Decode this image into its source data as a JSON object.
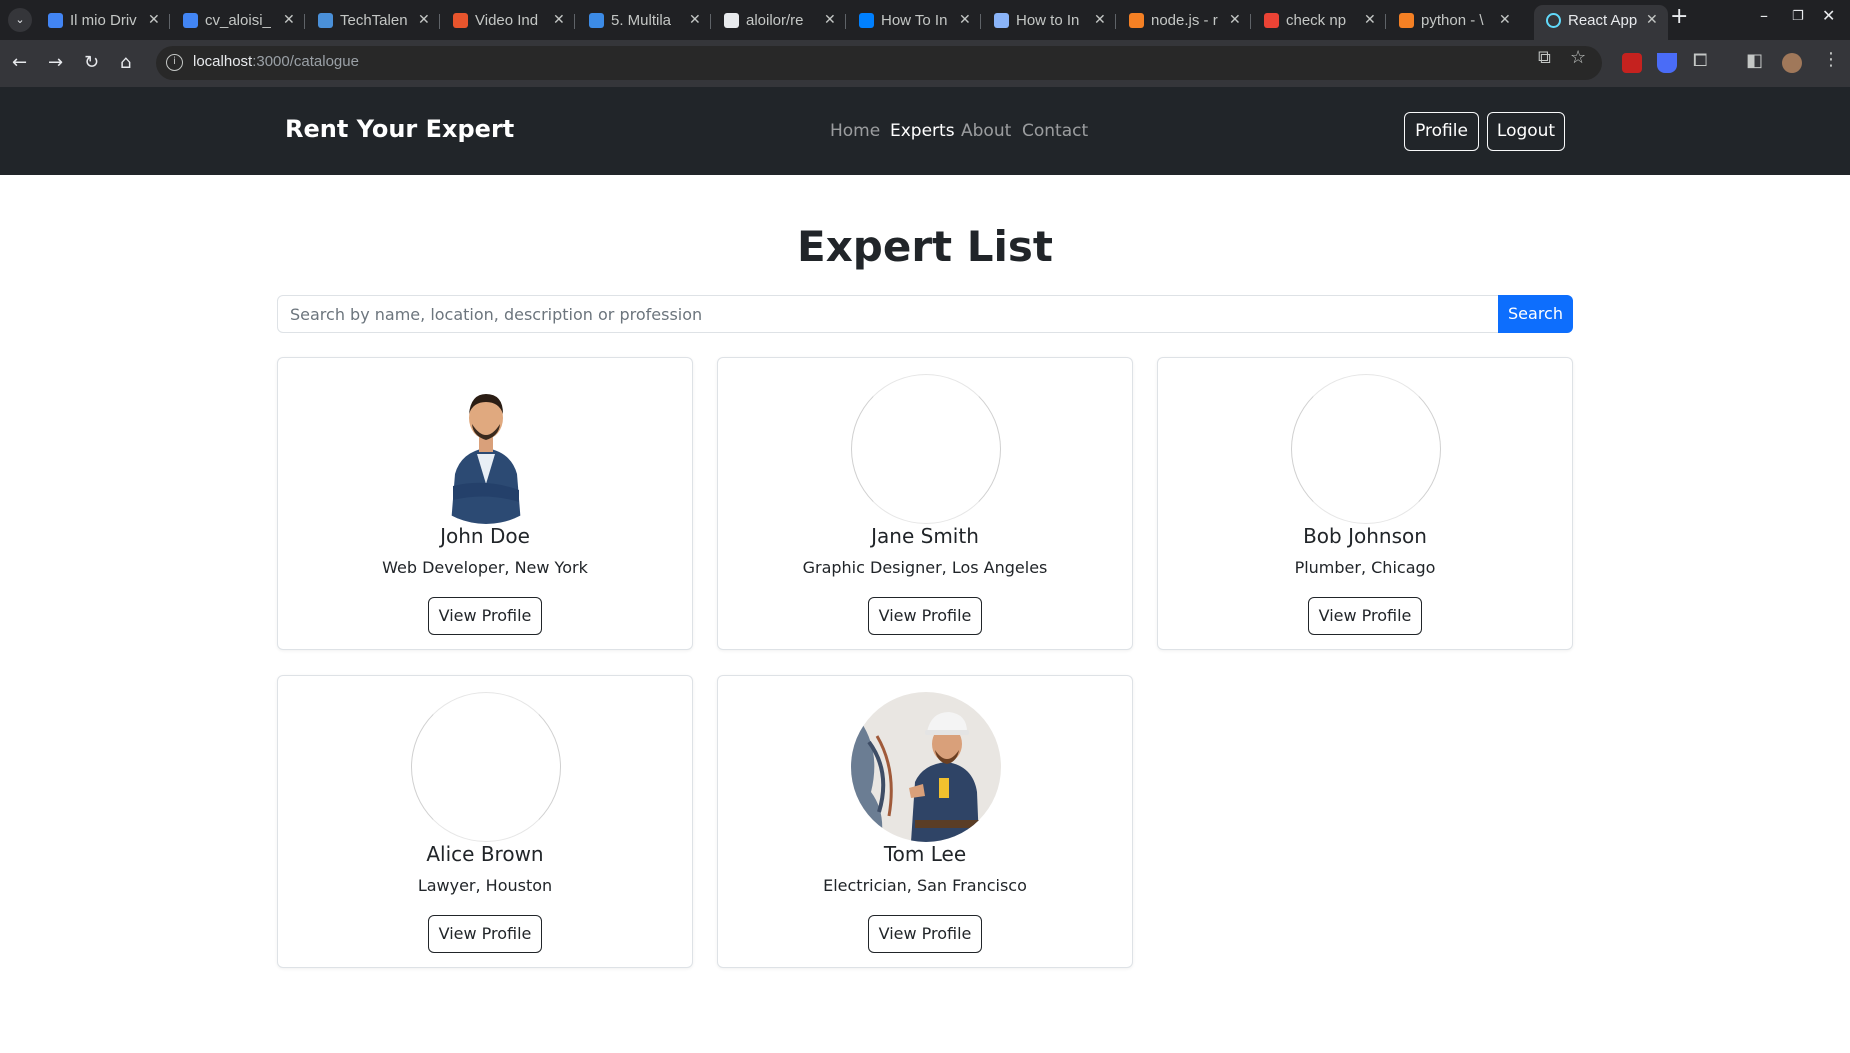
{
  "browser": {
    "tabs": [
      {
        "title": "Il mio Driv",
        "icon": "google-drive-icon",
        "color": "#4285f4"
      },
      {
        "title": "cv_aloisi_",
        "icon": "google-docs-icon",
        "color": "#4285f4"
      },
      {
        "title": "TechTalen",
        "icon": "laptop-icon",
        "color": "#4a90d9"
      },
      {
        "title": "Video Ind",
        "icon": "video-icon",
        "color": "#e8552d"
      },
      {
        "title": "5. Multila",
        "icon": "notes-icon",
        "color": "#3c8be6"
      },
      {
        "title": "aloilor/re",
        "icon": "github-icon",
        "color": "#e8eaed"
      },
      {
        "title": "How To In",
        "icon": "digitalocean-icon",
        "color": "#0080ff"
      },
      {
        "title": "How to In",
        "icon": "bookmark-icon",
        "color": "#8ab4f8"
      },
      {
        "title": "node.js - r",
        "icon": "stackoverflow-icon",
        "color": "#f48024"
      },
      {
        "title": "check np",
        "icon": "google-icon",
        "color": "#ea4335"
      },
      {
        "title": "python - \\",
        "icon": "stackoverflow-icon",
        "color": "#f48024"
      },
      {
        "title": "React App",
        "icon": "react-icon",
        "color": "#61dafb"
      }
    ],
    "url_host": "localhost",
    "url_path": ":3000/catalogue"
  },
  "nav": {
    "brand": "Rent Your Expert",
    "links": [
      "Home",
      "Experts",
      "About",
      "Contact"
    ],
    "active_link": "Experts",
    "profile_label": "Profile",
    "logout_label": "Logout"
  },
  "page": {
    "title": "Expert List",
    "search_placeholder": "Search by name, location, description or profession",
    "search_label": "Search"
  },
  "experts": [
    {
      "name": "John Doe",
      "subtitle": "Web Developer, New York",
      "button": "View Profile",
      "photo": "businessman"
    },
    {
      "name": "Jane Smith",
      "subtitle": "Graphic Designer, Los Angeles",
      "button": "View Profile",
      "photo": "broken"
    },
    {
      "name": "Bob Johnson",
      "subtitle": "Plumber, Chicago",
      "button": "View Profile",
      "photo": "broken"
    },
    {
      "name": "Alice Brown",
      "subtitle": "Lawyer, Houston",
      "button": "View Profile",
      "photo": "broken"
    },
    {
      "name": "Tom Lee",
      "subtitle": "Electrician, San Francisco",
      "button": "View Profile",
      "photo": "electrician"
    }
  ],
  "colors": {
    "navbar_bg": "#212529",
    "primary": "#0d6efd",
    "text": "#212529"
  }
}
